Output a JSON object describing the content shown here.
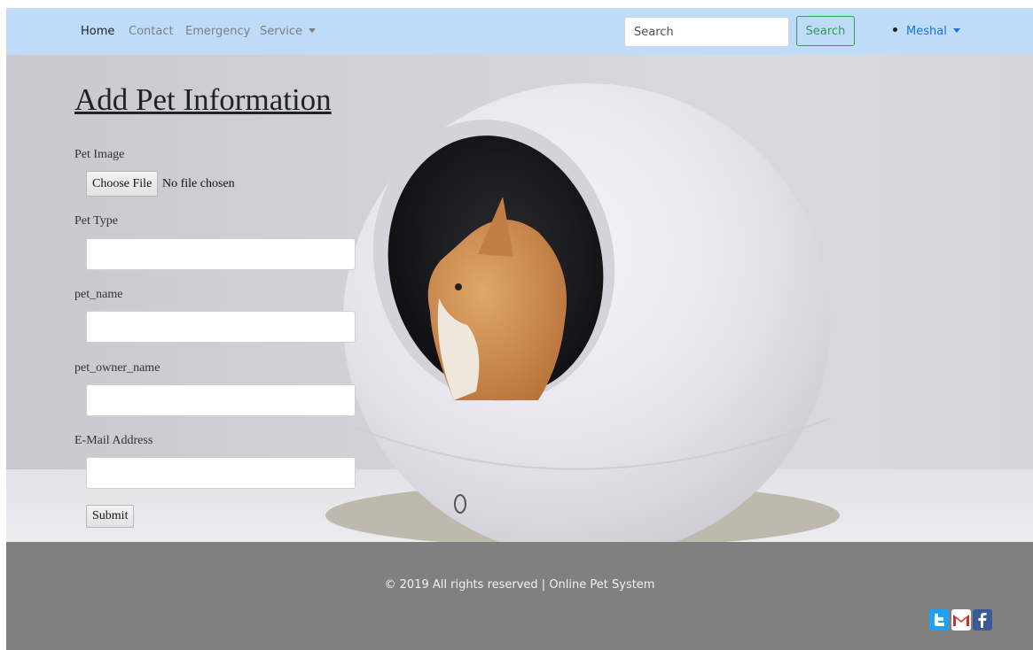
{
  "navbar": {
    "links": [
      "Home",
      "Contact",
      "Emergency",
      "Service"
    ],
    "search_placeholder": "Search",
    "search_button": "Search",
    "user_name": "Meshal"
  },
  "form": {
    "title": "Add Pet Information",
    "labels": {
      "pet_image": "Pet Image",
      "pet_type": "Pet Type",
      "pet_name": "pet_name",
      "pet_owner_name": "pet_owner_name",
      "email": "E-Mail Address"
    },
    "choose_file_button": "Choose File",
    "no_file_text": "No file chosen",
    "submit_button": "Submit"
  },
  "footer": {
    "copyright": "© 2019 All rights reserved | Online Pet System",
    "social_icons": [
      "twitter-icon",
      "gmail-icon",
      "facebook-icon"
    ]
  },
  "colors": {
    "navbar_bg": "#bedcf7",
    "footer_bg": "#808080",
    "search_button": "#2e9e5b",
    "user_link": "#1a73e8"
  }
}
